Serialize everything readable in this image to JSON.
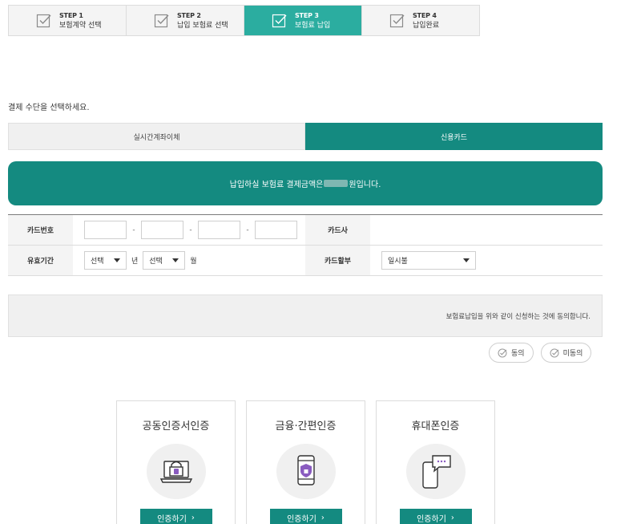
{
  "steps": [
    {
      "no": "STEP 1",
      "label": "보험계약 선택",
      "active": false
    },
    {
      "no": "STEP 2",
      "label": "납입 보험료 선택",
      "active": false
    },
    {
      "no": "STEP 3",
      "label": "보험료 납입",
      "active": true
    },
    {
      "no": "STEP 4",
      "label": "납입완료",
      "active": false
    }
  ],
  "instruction": "결제 수단을 선택하세요.",
  "tabs": [
    {
      "label": "실시간계좌이체",
      "active": false
    },
    {
      "label": "신용카드",
      "active": true
    }
  ],
  "banner": {
    "prefix": "납입하실 보험료 결제금액은 ",
    "suffix": "원입니다."
  },
  "form": {
    "card_number_label": "카드번호",
    "card_company_label": "카드사",
    "expiry_label": "유효기간",
    "expiry_year_value": "선택",
    "year_unit": "년",
    "expiry_month_value": "선택",
    "month_unit": "월",
    "installment_label": "카드할부",
    "installment_value": "일시불",
    "dash": "-"
  },
  "agreement": {
    "text": "보험료납입을 위와 같이 신청하는 것에 동의합니다.",
    "agree_label": "동의",
    "disagree_label": "미동의"
  },
  "auth": [
    {
      "title": "공동인증서인증",
      "button": "인증하기",
      "icon": "laptop-lock-icon"
    },
    {
      "title": "금융·간편인증",
      "button": "인증하기",
      "icon": "phone-shield-icon"
    },
    {
      "title": "휴대폰인증",
      "button": "인증하기",
      "icon": "phone-message-icon"
    }
  ],
  "colors": {
    "primary": "#148a80",
    "step_active": "#2bada0",
    "accent_purple": "#8a5cc0"
  }
}
